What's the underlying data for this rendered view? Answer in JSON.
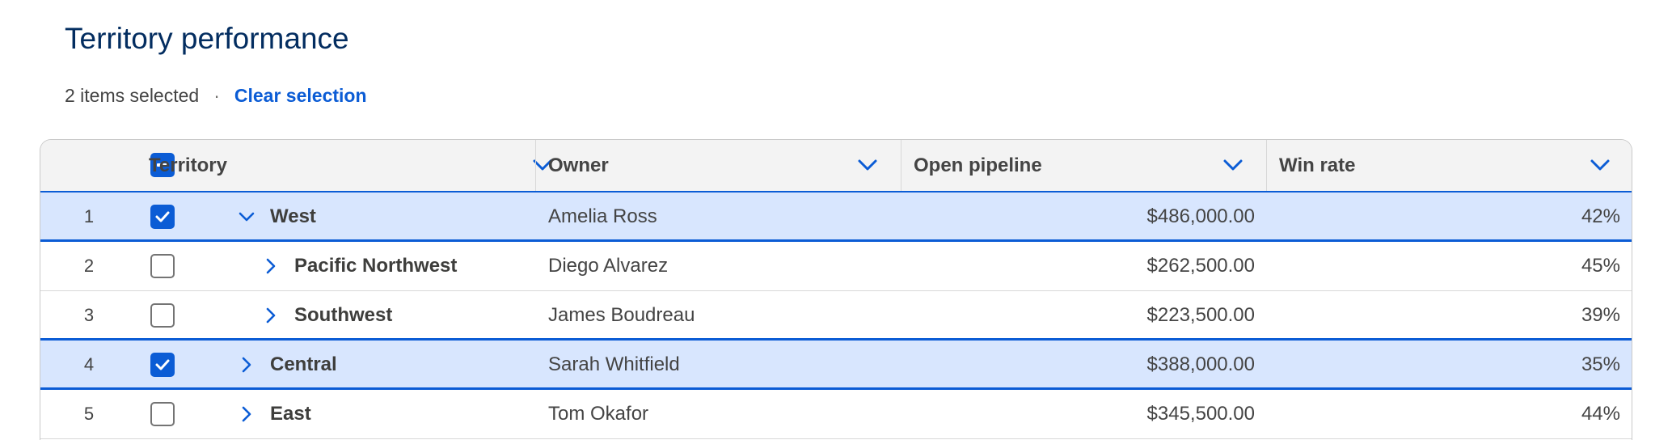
{
  "page": {
    "title": "Territory performance"
  },
  "selection": {
    "count_text": "2 items selected",
    "separator": "·",
    "clear_label": "Clear selection"
  },
  "table": {
    "columns": [
      {
        "label": "Territory"
      },
      {
        "label": "Owner"
      },
      {
        "label": "Open pipeline"
      },
      {
        "label": "Win rate"
      }
    ],
    "header_checkbox_state": "indeterminate",
    "rows": [
      {
        "index": "1",
        "selected": true,
        "expanded": true,
        "level": 1,
        "territory": "West",
        "owner": "Amelia Ross",
        "pipeline": "$486,000.00",
        "win_rate": "42%"
      },
      {
        "index": "2",
        "selected": false,
        "expanded": false,
        "level": 2,
        "territory": "Pacific Northwest",
        "owner": "Diego Alvarez",
        "pipeline": "$262,500.00",
        "win_rate": "45%"
      },
      {
        "index": "3",
        "selected": false,
        "expanded": false,
        "level": 2,
        "territory": "Southwest",
        "owner": "James Boudreau",
        "pipeline": "$223,500.00",
        "win_rate": "39%"
      },
      {
        "index": "4",
        "selected": true,
        "expanded": false,
        "level": 1,
        "territory": "Central",
        "owner": "Sarah Whitfield",
        "pipeline": "$388,000.00",
        "win_rate": "35%"
      },
      {
        "index": "5",
        "selected": false,
        "expanded": false,
        "level": 1,
        "territory": "East",
        "owner": "Tom Okafor",
        "pipeline": "$345,500.00",
        "win_rate": "44%"
      }
    ]
  },
  "icons": {
    "column_menu": "chevron-down-icon",
    "row_expanded": "chevron-down-icon",
    "row_collapsed": "chevron-right-icon",
    "checked": "check-icon",
    "indeterminate": "minus-icon"
  },
  "colors": {
    "title": "#032d60",
    "accent": "#0b5cd5",
    "selected_row_bg": "#d8e6fe",
    "header_bg": "#f3f3f3",
    "border": "#c9c9c9"
  }
}
